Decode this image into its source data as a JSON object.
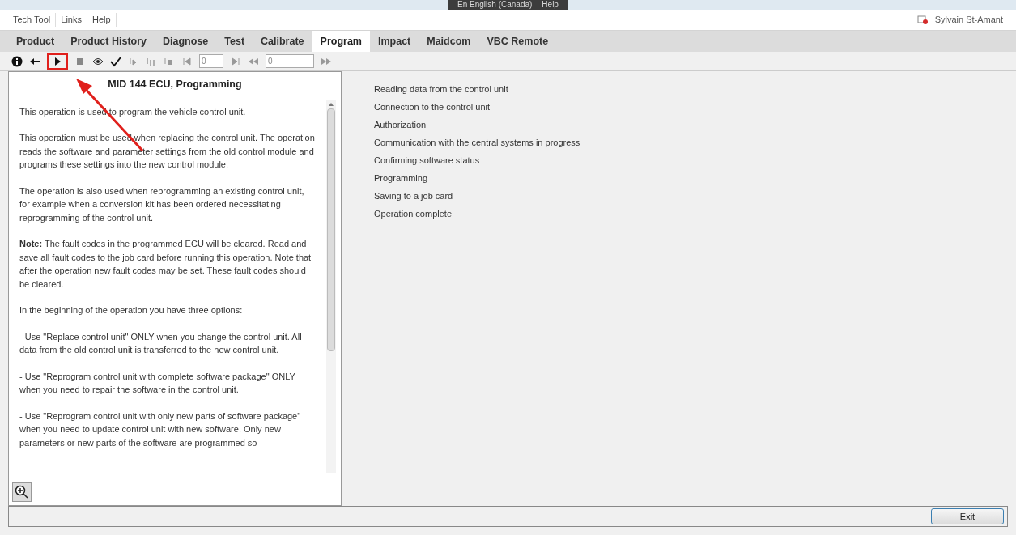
{
  "top_bar": {
    "language": "En English (Canada)",
    "help": "Help"
  },
  "menu": {
    "items": [
      "Tech Tool",
      "Links",
      "Help"
    ],
    "user": "Sylvain St-Amant"
  },
  "tabs": [
    {
      "label": "Product",
      "selected": false
    },
    {
      "label": "Product History",
      "selected": false
    },
    {
      "label": "Diagnose",
      "selected": false
    },
    {
      "label": "Test",
      "selected": false
    },
    {
      "label": "Calibrate",
      "selected": false
    },
    {
      "label": "Program",
      "selected": true
    },
    {
      "label": "Impact",
      "selected": false
    },
    {
      "label": "Maidcom",
      "selected": false
    },
    {
      "label": "VBC Remote",
      "selected": false
    }
  ],
  "toolbar": {
    "step_field": {
      "value": "0"
    },
    "jump_field": {
      "value": "0"
    }
  },
  "description": {
    "title": "MID 144 ECU, Programming",
    "paragraphs": [
      "This operation is used to program the vehicle control unit.",
      "This operation must be used when replacing the control unit. The operation reads the software and parameter settings from the old control module and programs these settings into the new control module.",
      "The operation is also used when reprogramming an existing control unit, for example when a conversion kit has been ordered necessitating reprogramming of the control unit.",
      "**Note:** The fault codes in the programmed ECU will be cleared. Read and save all fault codes to the job card before running this operation. Note that after the operation new fault codes may be set. These fault codes should be cleared.",
      "In the beginning of the operation you have three options:",
      "- Use \"Replace control unit\" ONLY when you change the control unit. All data from the old control unit is transferred to the new control unit.",
      "- Use \"Reprogram control unit with complete software package\" ONLY when you need to repair the software in the control unit.",
      "- Use \"Reprogram control unit with only new parts of software package\" when you need to update control unit with new software. Only new parameters or new parts of the software are programmed so"
    ]
  },
  "steps": [
    "Reading data from the control unit",
    "Connection to the control unit",
    "Authorization",
    "Communication with the central systems in progress",
    "Confirming software status",
    "Programming",
    "Saving to a job card",
    "Operation complete"
  ],
  "exit_button": "Exit"
}
